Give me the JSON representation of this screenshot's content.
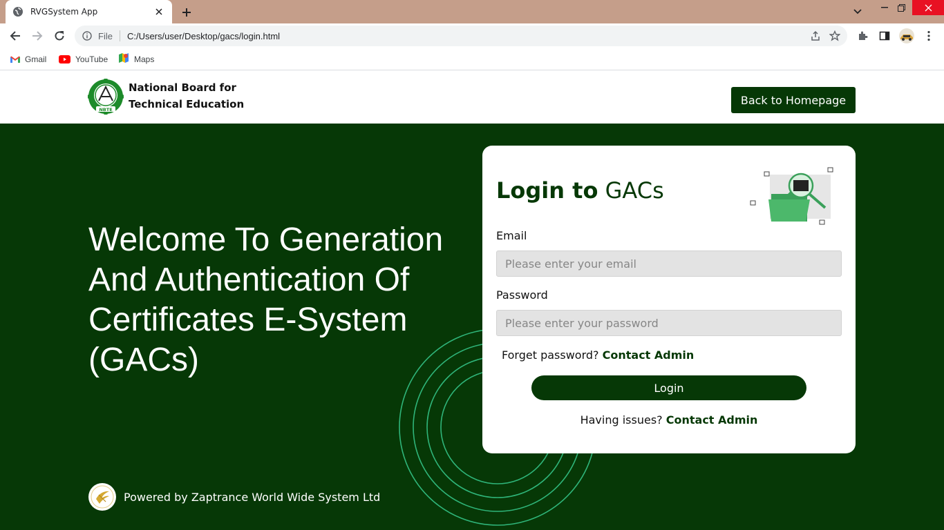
{
  "browser": {
    "tab_title": "RVGSystem App",
    "omnibox_scheme": "File",
    "url": "C:/Users/user/Desktop/gacs/login.html",
    "bookmarks": [
      {
        "label": "Gmail",
        "icon": "gmail-icon"
      },
      {
        "label": "YouTube",
        "icon": "youtube-icon"
      },
      {
        "label": "Maps",
        "icon": "maps-icon"
      }
    ]
  },
  "header": {
    "org_name_line1": "National Board for",
    "org_name_line2": "Technical Education",
    "logo_text": "NBTE",
    "back_button": "Back to Homepage"
  },
  "hero": {
    "welcome": "Welcome To Generation And Authentication Of Certificates E-System (GACs)"
  },
  "login": {
    "title_bold": "Login to",
    "title_rest": "GACs",
    "email_label": "Email",
    "email_placeholder": "Please enter your email",
    "email_value": "",
    "password_label": "Password",
    "password_placeholder": "Please enter your password",
    "password_value": "",
    "forget_text": "Forget password?",
    "forget_link": "Contact Admin",
    "login_button": "Login",
    "issues_text": "Having issues?",
    "issues_link": "Contact Admin"
  },
  "footer": {
    "powered_by": "Powered by Zaptrance World Wide System Ltd"
  },
  "colors": {
    "brand_green": "#063806",
    "ring_green": "#2fb57a",
    "tabstrip": "#c59e8a"
  }
}
